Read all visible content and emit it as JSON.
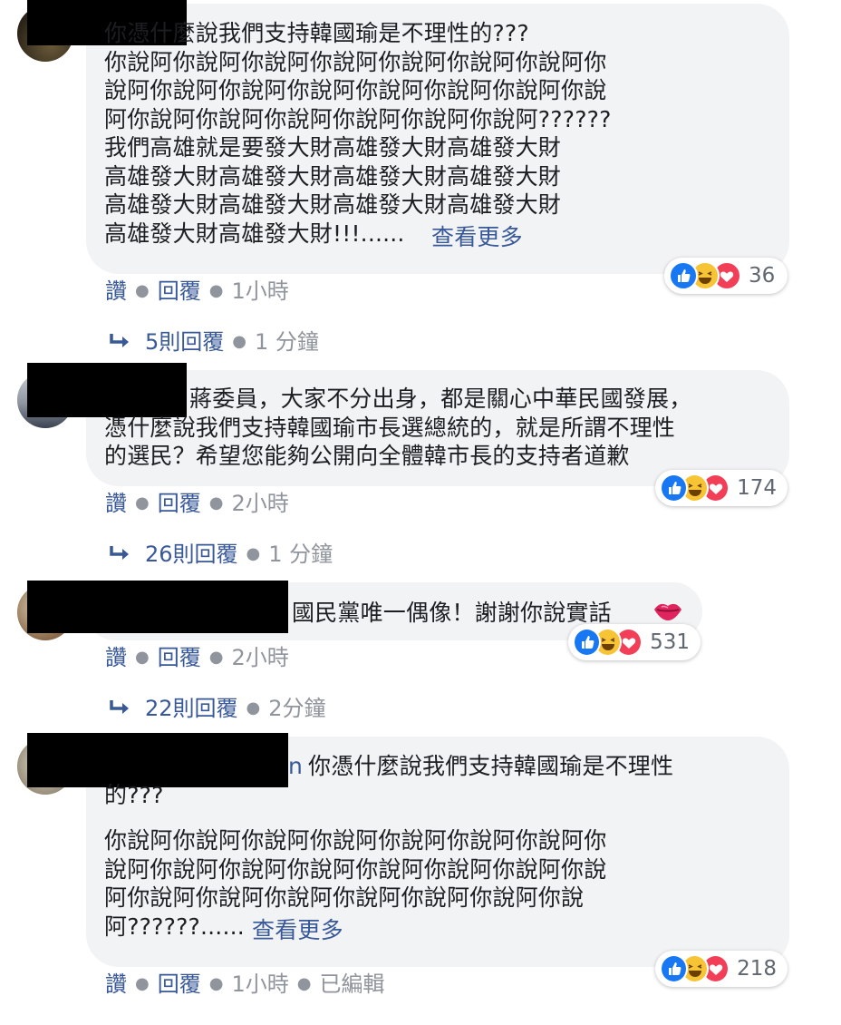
{
  "ui": {
    "like": "讚",
    "reply": "回覆",
    "edited": "已編輯"
  },
  "reaction_colors": {
    "like": "#1877f2",
    "haha": "#f7c436",
    "love": "#f33e58"
  },
  "comments": [
    {
      "text": "你憑什麼說我們支持韓國瑜是不理性的???\n你說阿你說阿你說阿你說阿你說阿你說阿你說阿你\n說阿你說阿你說阿你說阿你說阿你說阿你說阿你說\n阿你說阿你說阿你說阿你說阿你說阿你說阿??????\n我們高雄就是要發大財高雄發大財高雄發大財\n高雄發大財高雄發大財高雄發大財高雄發大財\n高雄發大財高雄發大財高雄發大財高雄發大財\n高雄發大財高雄發大財!!!......",
      "see_more": "查看更多",
      "reaction_count": "36",
      "time": "1小時",
      "replies_label": "5則回覆",
      "replies_time": "1 分鐘"
    },
    {
      "text": "蔣委員，大家不分出身，都是關心中華民國發展，\n憑什麼說我們支持韓國瑜市長選總統的，就是所謂不理性\n的選民？希望您能夠公開向全體韓市長的支持者道歉",
      "reaction_count": "174",
      "time": "2小時",
      "replies_label": "26則回覆",
      "replies_time": "1 分鐘"
    },
    {
      "text": "國民黨唯一偶像！謝謝你說實話",
      "emoji": "lips-emoji",
      "reaction_count": "531",
      "time": "2小時",
      "replies_label": "22則回覆",
      "replies_time": "2分鐘"
    },
    {
      "name_tail": "n",
      "text_line1": "你憑什麼說我們支持韓國瑜是不理性",
      "text_line2": "的???",
      "text_body": "你說阿你說阿你說阿你說阿你說阿你說阿你說阿你\n說阿你說阿你說阿你說阿你說阿你說阿你說阿你說\n阿你說阿你說阿你說阿你說阿你說阿你說阿你說\n阿??????......",
      "see_more": "查看更多",
      "reaction_count": "218",
      "time": "1小時"
    }
  ]
}
